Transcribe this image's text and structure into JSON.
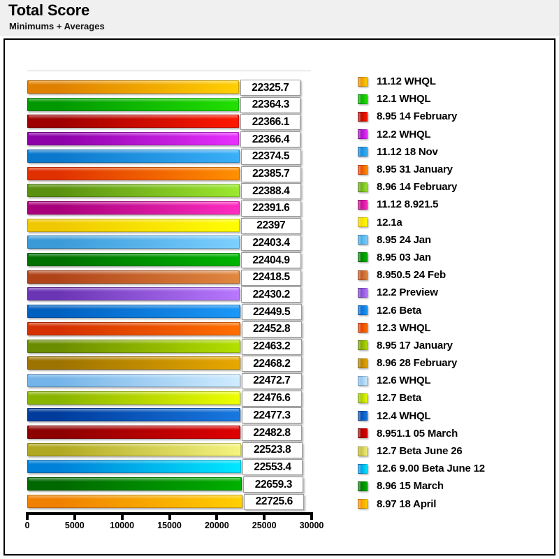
{
  "header": {
    "title": "Total Score",
    "subtitle": "Minimums + Averages"
  },
  "chart_data": {
    "type": "bar",
    "orientation": "horizontal",
    "title": "Total Score",
    "subtitle": "Minimums + Averages",
    "xlabel": "",
    "ylabel": "",
    "xlim": [
      0,
      30000
    ],
    "xticks": [
      "0",
      "5000",
      "10000",
      "15000",
      "20000",
      "25000",
      "30000"
    ],
    "grid": false,
    "legend_position": "right",
    "categories": [
      "11.12 WHQL",
      "12.1 WHQL",
      "8.95 14 February",
      "12.2 WHQL",
      "11.12 18 Nov",
      "8.95 31 January",
      "8.96 14 February",
      "11.12 8.921.5",
      "12.1a",
      "8.95 24 Jan",
      "8.95 03 Jan",
      "8.950.5 24 Feb",
      "12.2 Preview",
      "12.6 Beta",
      "12.3 WHQL",
      "8.95 17 January",
      "8.96 28 February",
      "12.6 WHQL",
      "12.7 Beta",
      "12.4 WHQL",
      "8.951.1 05 March",
      "12.7 Beta June 26",
      "12.6 9.00 Beta June 12",
      "8.96 15 March",
      "8.97 18 April"
    ],
    "values": [
      22325.7,
      22364.3,
      22366.1,
      22366.4,
      22374.5,
      22385.7,
      22388.4,
      22391.6,
      22397,
      22403.4,
      22404.9,
      22418.5,
      22430.2,
      22449.5,
      22452.8,
      22463.2,
      22468.2,
      22472.7,
      22476.6,
      22477.3,
      22482.8,
      22523.8,
      22553.4,
      22659.3,
      22725.6
    ],
    "value_labels": [
      "22325.7",
      "22364.3",
      "22366.1",
      "22366.4",
      "22374.5",
      "22385.7",
      "22388.4",
      "22391.6",
      "22397",
      "22403.4",
      "22404.9",
      "22418.5",
      "22430.2",
      "22449.5",
      "22452.8",
      "22463.2",
      "22468.2",
      "22472.7",
      "22476.6",
      "22477.3",
      "22482.8",
      "22523.8",
      "22553.4",
      "22659.3",
      "22725.6"
    ],
    "colors_dark": [
      "#e08000",
      "#009800",
      "#9e0000",
      "#8c00a8",
      "#0a78cc",
      "#e03000",
      "#5a9010",
      "#a8007a",
      "#f0c800",
      "#3a9ad8",
      "#007000",
      "#b04418",
      "#6a34b4",
      "#0060c0",
      "#d43000",
      "#6a8c00",
      "#9c7200",
      "#74b4e8",
      "#88b400",
      "#003c9c",
      "#8c0000",
      "#b0a820",
      "#0080d8",
      "#006800",
      "#f08000"
    ],
    "colors_light": [
      "#ffd000",
      "#22e000",
      "#ff1800",
      "#e830ff",
      "#3ab0f8",
      "#ff9000",
      "#9ce830",
      "#ff2cc0",
      "#ffff00",
      "#7cd0ff",
      "#00b400",
      "#e08840",
      "#b878ff",
      "#1c98f8",
      "#ff7000",
      "#b4e000",
      "#e8a800",
      "#d0ecff",
      "#eeff00",
      "#1878e0",
      "#e00000",
      "#f4f480",
      "#00e8ff",
      "#00b000",
      "#ffd000"
    ]
  },
  "legend": {
    "items": [
      {
        "label": "11.12 WHQL",
        "dark": "#e08000",
        "light": "#ffd000"
      },
      {
        "label": "12.1 WHQL",
        "dark": "#009800",
        "light": "#22e000"
      },
      {
        "label": "8.95 14 February",
        "dark": "#9e0000",
        "light": "#ff1800"
      },
      {
        "label": "12.2 WHQL",
        "dark": "#8c00a8",
        "light": "#e830ff"
      },
      {
        "label": "11.12 18 Nov",
        "dark": "#0a78cc",
        "light": "#3ab0f8"
      },
      {
        "label": "8.95 31 January",
        "dark": "#e03000",
        "light": "#ff9000"
      },
      {
        "label": "8.96 14 February",
        "dark": "#5a9010",
        "light": "#9ce830"
      },
      {
        "label": "11.12 8.921.5",
        "dark": "#a8007a",
        "light": "#ff2cc0"
      },
      {
        "label": "12.1a",
        "dark": "#f0c800",
        "light": "#ffff00"
      },
      {
        "label": "8.95 24 Jan",
        "dark": "#3a9ad8",
        "light": "#7cd0ff"
      },
      {
        "label": "8.95 03 Jan",
        "dark": "#007000",
        "light": "#00b400"
      },
      {
        "label": "8.950.5 24 Feb",
        "dark": "#b04418",
        "light": "#e08840"
      },
      {
        "label": "12.2 Preview",
        "dark": "#6a34b4",
        "light": "#b878ff"
      },
      {
        "label": "12.6 Beta",
        "dark": "#0060c0",
        "light": "#1c98f8"
      },
      {
        "label": "12.3 WHQL",
        "dark": "#d43000",
        "light": "#ff7000"
      },
      {
        "label": "8.95 17 January",
        "dark": "#6a8c00",
        "light": "#b4e000"
      },
      {
        "label": "8.96 28 February",
        "dark": "#9c7200",
        "light": "#e8a800"
      },
      {
        "label": "12.6 WHQL",
        "dark": "#74b4e8",
        "light": "#d0ecff"
      },
      {
        "label": "12.7 Beta",
        "dark": "#88b400",
        "light": "#eeff00"
      },
      {
        "label": "12.4 WHQL",
        "dark": "#003c9c",
        "light": "#1878e0"
      },
      {
        "label": "8.951.1 05 March",
        "dark": "#8c0000",
        "light": "#e00000"
      },
      {
        "label": "12.7 Beta June 26",
        "dark": "#b0a820",
        "light": "#f4f480"
      },
      {
        "label": "12.6 9.00 Beta June 12",
        "dark": "#0080d8",
        "light": "#00e8ff"
      },
      {
        "label": "8.96 15 March",
        "dark": "#006800",
        "light": "#00b000"
      },
      {
        "label": "8.97 18 April",
        "dark": "#f08000",
        "light": "#ffd000"
      }
    ]
  }
}
